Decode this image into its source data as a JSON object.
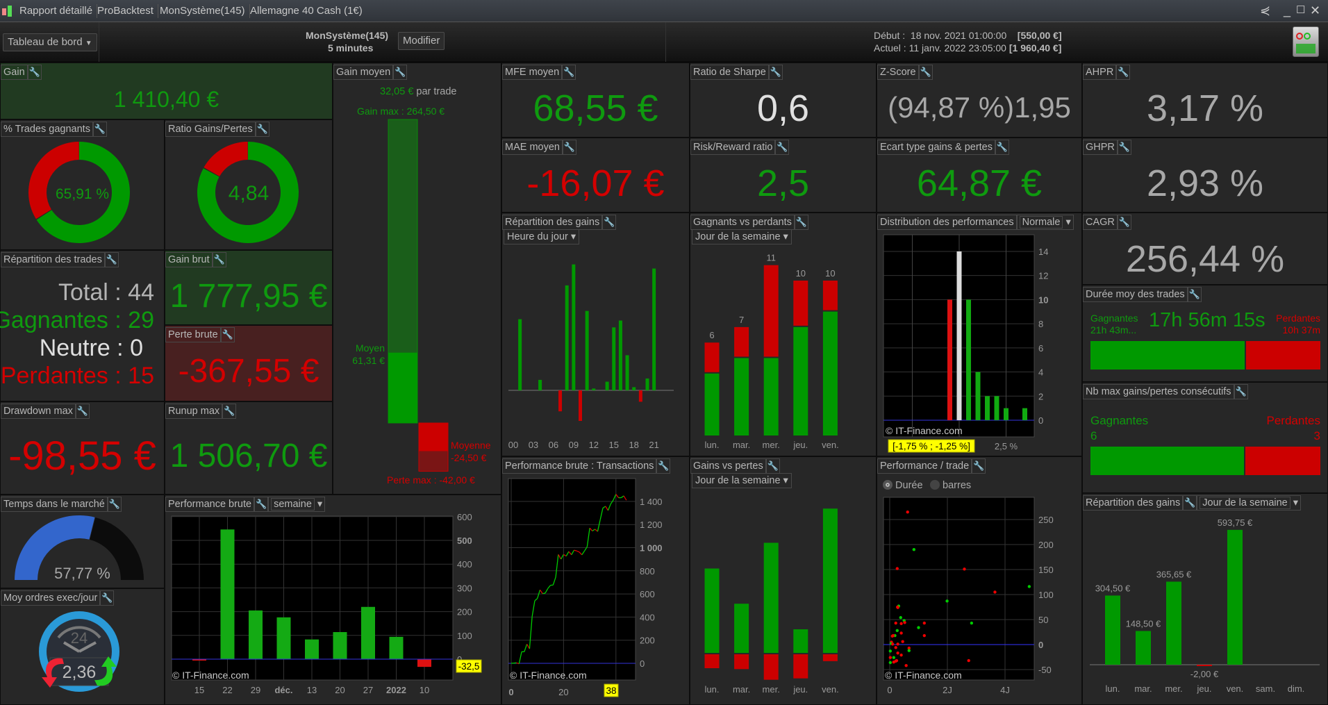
{
  "titlebar": {
    "tabs": [
      "Rapport détaillé",
      "ProBacktest",
      "MonSystème(145)",
      "Allemagne 40 Cash (1€)"
    ]
  },
  "header": {
    "view_select": "Tableau de bord",
    "system": "MonSystème(145)",
    "timeframe": "5 minutes",
    "modify": "Modifier",
    "start_label": "Début :",
    "start_date": "18 nov. 2021 01:00:00",
    "start_capital": "[550,00 €]",
    "current_label": "Actuel :",
    "current_date": "11 janv. 2022 23:05:00",
    "current_capital": "[1 960,40 €]"
  },
  "colors": {
    "green": "#0f9a0f",
    "red": "#d40000",
    "blue": "#3366cc",
    "panel": "#272727",
    "cursor": "#ffff00"
  },
  "panels": {
    "gain": {
      "title": "Gain",
      "value": "1 410,40 €"
    },
    "pct_win": {
      "title": "% Trades gagnants",
      "value": "65,91 %",
      "fraction": 0.6591
    },
    "ratio": {
      "title": "Ratio Gains/Pertes",
      "value": "4,84",
      "fraction": 0.8288
    },
    "repart_trades": {
      "title": "Répartition des trades",
      "total": "Total : 44",
      "wins": "Gagnantes : 29",
      "neutral": "Neutre : 0",
      "losses": "Perdantes : 15"
    },
    "gain_brut": {
      "title": "Gain brut",
      "value": "1 777,95 €"
    },
    "perte_brute": {
      "title": "Perte brute",
      "value": "-367,55 €"
    },
    "drawdown": {
      "title": "Drawdown max",
      "value": "-98,55 €"
    },
    "runup": {
      "title": "Runup max",
      "value": "1 506,70 €"
    },
    "temps": {
      "title": "Temps dans le marché",
      "value": "57,77 %",
      "fraction": 0.5777
    },
    "ordres": {
      "title": "Moy ordres exec/jour",
      "value": "2,36",
      "clock_label": "24"
    },
    "gain_moyen": {
      "title": "Gain moyen",
      "avg": "32,05 €",
      "per_trade": "par trade",
      "gain_max_label": "Gain max : 264,50 €",
      "avg_gain_label": "Moyen",
      "avg_gain_value": "61,31 €",
      "avg_loss_label": "Moyenne",
      "avg_loss_value": "-24,50 €",
      "loss_max_label": "Perte max : -42,00 €",
      "gain_max": 264.5,
      "avg_gain": 61.31,
      "avg_loss": -24.5,
      "loss_max": -42.0
    },
    "mfe": {
      "title": "MFE moyen",
      "value": "68,55 €"
    },
    "mae": {
      "title": "MAE moyen",
      "value": "-16,07 €"
    },
    "sharpe": {
      "title": "Ratio de Sharpe",
      "value": "0,6"
    },
    "rr": {
      "title": "Risk/Reward ratio",
      "value": "2,5"
    },
    "zscore": {
      "title": "Z-Score",
      "value": "(94,87 %)1,95"
    },
    "ecart": {
      "title": "Ecart type gains & pertes",
      "value": "64,87 €"
    },
    "ahpr": {
      "title": "AHPR",
      "value": "3,17 %"
    },
    "ghpr": {
      "title": "GHPR",
      "value": "2,93 %"
    },
    "cagr": {
      "title": "CAGR",
      "value": "256,44 %"
    },
    "duree": {
      "title": "Durée moy des trades",
      "win_label": "Gagnantes",
      "win_value": "21h 43m...",
      "avg": "17h 56m 15s",
      "loss_label": "Perdantes",
      "loss_value": "10h 37m",
      "win_fraction": 0.67
    },
    "nbmax": {
      "title": "Nb max gains/pertes consécutifs",
      "win_label": "Gagnantes",
      "win_value": "6",
      "loss_label": "Perdantes",
      "loss_value": "3",
      "win_fraction": 0.667
    },
    "rep_heure": {
      "title": "Répartition des gains",
      "select": "Heure du jour"
    },
    "gvp": {
      "title": "Gagnants vs perdants",
      "select": "Jour de la semaine"
    },
    "distrib": {
      "title": "Distribution des performances",
      "select": "Normale"
    },
    "perf_semaine": {
      "title": "Performance brute",
      "select": "semaine"
    },
    "perf_trans": {
      "title": "Performance brute : Transactions"
    },
    "gains_pertes": {
      "title": "Gains vs pertes",
      "select": "Jour de la semaine"
    },
    "perf_trade": {
      "title": "Performance / trade",
      "radio1": "Durée",
      "radio2": "barres"
    },
    "rep_jour": {
      "title": "Répartition des gains",
      "select": "Jour de la semaine"
    }
  },
  "chart_data": [
    {
      "id": "rep_heure",
      "type": "bar",
      "x": [
        1,
        4,
        7,
        8,
        9,
        10,
        11,
        12,
        14,
        15,
        16,
        17,
        18,
        19,
        20,
        21
      ],
      "values": [
        156,
        23,
        -46,
        230,
        276,
        -67,
        174,
        4,
        19,
        138,
        153,
        77,
        7,
        -25,
        26,
        267
      ],
      "xticks": [
        "00",
        "03",
        "06",
        "09",
        "12",
        "15",
        "18",
        "21"
      ]
    },
    {
      "id": "gvp",
      "type": "bar",
      "stacked": true,
      "categories": [
        "lun.",
        "mar.",
        "mer.",
        "jeu.",
        "ven."
      ],
      "series": [
        {
          "values": [
            4,
            5,
            5,
            7,
            8
          ]
        },
        {
          "values": [
            2,
            2,
            6,
            3,
            2
          ]
        }
      ],
      "totals": [
        "6",
        "7",
        "11",
        "10",
        "10"
      ]
    },
    {
      "id": "gains_pertes",
      "type": "bar",
      "categories": [
        "lun.",
        "mar.",
        "mer.",
        "jeu.",
        "ven."
      ],
      "series": [
        {
          "values": [
            364.5,
            212.5,
            475.65,
            102,
            623.35
          ]
        },
        {
          "values": [
            -60,
            -64,
            -110,
            -104,
            -29.6
          ]
        }
      ]
    },
    {
      "id": "distrib",
      "type": "bar",
      "x": [
        -0.5,
        0,
        0.5,
        1,
        1.5,
        2,
        2.5,
        3.5
      ],
      "values": [
        10,
        14,
        10,
        4,
        2,
        2,
        1,
        1
      ],
      "bar_colors": [
        "#dd1111",
        "#dddddd",
        "#11aa11",
        "#11aa11",
        "#11aa11",
        "#11aa11",
        "#11aa11",
        "#11aa11"
      ],
      "yticks": [
        "0",
        "2",
        "4",
        "6",
        "8",
        "10",
        "12",
        "14"
      ],
      "xtick": "2,5 %",
      "cursor_label": "[-1,75 % ; -1,25 %]",
      "watermark": "© IT-Finance.com",
      "grid": true
    },
    {
      "id": "perf_semaine",
      "type": "bar",
      "categories": [
        "15",
        "22",
        "29",
        "déc.",
        "13",
        "20",
        "27",
        "2022",
        "10"
      ],
      "values": [
        -3,
        546,
        205,
        176,
        83,
        114,
        220,
        94,
        -32.5
      ],
      "yticks": [
        "0",
        "100",
        "200",
        "300",
        "400",
        "500",
        "600"
      ],
      "ylim": [
        -55,
        630
      ],
      "cursor_label": "-32,5",
      "watermark": "© IT-Finance.com",
      "grid": true
    },
    {
      "id": "perf_trans",
      "type": "line",
      "x_start": 0,
      "values": [
        0,
        2,
        4,
        -4,
        100,
        100,
        166,
        126,
        405,
        541,
        561,
        635,
        603,
        607,
        647,
        675,
        677,
        745,
        941,
        901,
        941,
        927,
        967,
        939,
        978,
        972,
        962,
        938,
        972,
        1008,
        1170,
        1144,
        1160,
        1140,
        1242,
        1342,
        1358,
        1322,
        1378,
        1412,
        1462,
        1432,
        1432,
        1448,
        1410.4
      ],
      "yticks": [
        "0",
        "200",
        "400",
        "600",
        "800",
        "1 000",
        "1 200",
        "1 400"
      ],
      "xticks": [
        "0",
        "20"
      ],
      "cursor_label": "38",
      "watermark": "© IT-Finance.com",
      "grid": true
    },
    {
      "id": "perf_trade",
      "type": "scatter",
      "points": [
        [
          0.62,
          265,
          "r"
        ],
        [
          0.84,
          190,
          "g"
        ],
        [
          0.26,
          152,
          "r"
        ],
        [
          2.59,
          151,
          "r"
        ],
        [
          3.65,
          105,
          "r"
        ],
        [
          4.84,
          116,
          "g"
        ],
        [
          1.99,
          87,
          "g"
        ],
        [
          0.31,
          77,
          "g"
        ],
        [
          0.27,
          75,
          "r"
        ],
        [
          0.28,
          74,
          "r"
        ],
        [
          0.38,
          54,
          "g"
        ],
        [
          0.5,
          48,
          "g"
        ],
        [
          0.21,
          43,
          "r"
        ],
        [
          0.4,
          42,
          "r"
        ],
        [
          0.52,
          44,
          "r"
        ],
        [
          1.2,
          43,
          "r"
        ],
        [
          2.84,
          43,
          "g"
        ],
        [
          1.0,
          34,
          "g"
        ],
        [
          0.26,
          28,
          "g"
        ],
        [
          0.4,
          23,
          "r"
        ],
        [
          0.18,
          18,
          "g"
        ],
        [
          0.09,
          17,
          "r"
        ],
        [
          0.12,
          18,
          "r"
        ],
        [
          1.2,
          18,
          "r"
        ],
        [
          0.45,
          6,
          "r"
        ],
        [
          0.06,
          5,
          "r"
        ],
        [
          0.05,
          2,
          "g"
        ],
        [
          0.1,
          1,
          "r"
        ],
        [
          0.28,
          1,
          "r"
        ],
        [
          0.21,
          -6,
          "r"
        ],
        [
          0.67,
          -7,
          "r"
        ],
        [
          0.67,
          -12,
          "g"
        ],
        [
          0.02,
          -13,
          "g"
        ],
        [
          0.28,
          -17,
          "r"
        ],
        [
          0.4,
          -21,
          "r"
        ],
        [
          0.02,
          -26,
          "r"
        ],
        [
          0.14,
          -26,
          "g"
        ],
        [
          0.21,
          -33,
          "r"
        ],
        [
          0.24,
          -32,
          "r"
        ],
        [
          0.14,
          -35,
          "r"
        ],
        [
          2.74,
          -32,
          "r"
        ],
        [
          0.02,
          -36,
          "g"
        ],
        [
          0.57,
          -42,
          "r"
        ]
      ],
      "yticks": [
        "-50",
        "0",
        "50",
        "100",
        "150",
        "200",
        "250"
      ],
      "xticks": [
        "0",
        "2J",
        "4J"
      ],
      "watermark": "© IT-Finance.com",
      "grid": true
    },
    {
      "id": "rep_jour",
      "type": "bar",
      "categories": [
        "lun.",
        "mar.",
        "mer.",
        "jeu.",
        "ven.",
        "sam.",
        "dim."
      ],
      "values": [
        304.5,
        148.5,
        365.65,
        -2,
        593.75,
        0,
        0
      ],
      "labels": [
        "304,50 €",
        "148,50 €",
        "365,65 €",
        "-2,00 €",
        "593,75 €",
        "",
        ""
      ]
    }
  ]
}
